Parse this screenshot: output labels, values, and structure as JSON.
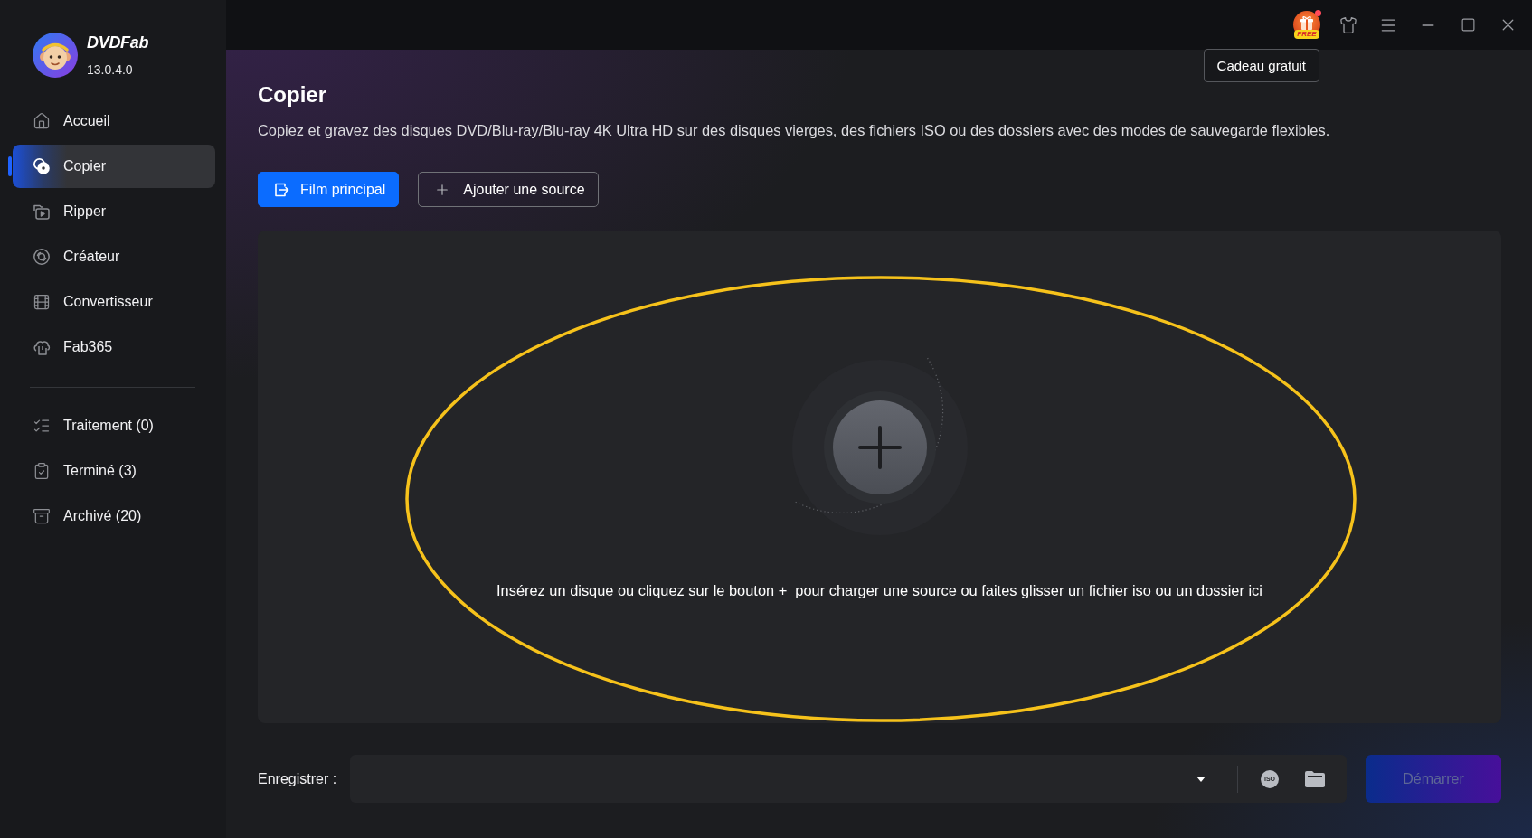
{
  "app": {
    "name": "DVDFab",
    "version": "13.0.4.0"
  },
  "sidebar": {
    "nav": [
      {
        "label": "Accueil",
        "selected": false
      },
      {
        "label": "Copier",
        "selected": true
      },
      {
        "label": "Ripper",
        "selected": false
      },
      {
        "label": "Créateur",
        "selected": false
      },
      {
        "label": "Convertisseur",
        "selected": false
      },
      {
        "label": "Fab365",
        "selected": false
      }
    ],
    "queues": [
      {
        "label": "Traitement (0)",
        "selected": false
      },
      {
        "label": "Terminé (3)",
        "selected": false
      },
      {
        "label": "Archivé (20)",
        "selected": false
      }
    ]
  },
  "title_bar": {
    "gift": {
      "label": "FREE",
      "notification": true
    },
    "tooltip": "Cadeau gratuit"
  },
  "page": {
    "title": "Copier",
    "description": "Copiez et gravez des disques DVD/Blu-ray/Blu-ray 4K Ultra HD sur des disques vierges, des fichiers ISO ou des dossiers avec des modes de sauvegarde flexibles.",
    "actions": [
      {
        "label": "Film principal",
        "kind": "primary"
      },
      {
        "label": "Ajouter une source",
        "kind": "outline"
      }
    ]
  },
  "drop_zone": {
    "hint": "Insérez un disque ou cliquez sur le bouton +  pour charger une source ou faites glisser un fichier iso ou un dossier ici",
    "annotation": {
      "kind": "ellipse"
    }
  },
  "save_bar": {
    "label": "Enregistrer :",
    "iso_label": "ISO"
  },
  "start_button": {
    "label": "Démarrer",
    "disabled": true
  }
}
